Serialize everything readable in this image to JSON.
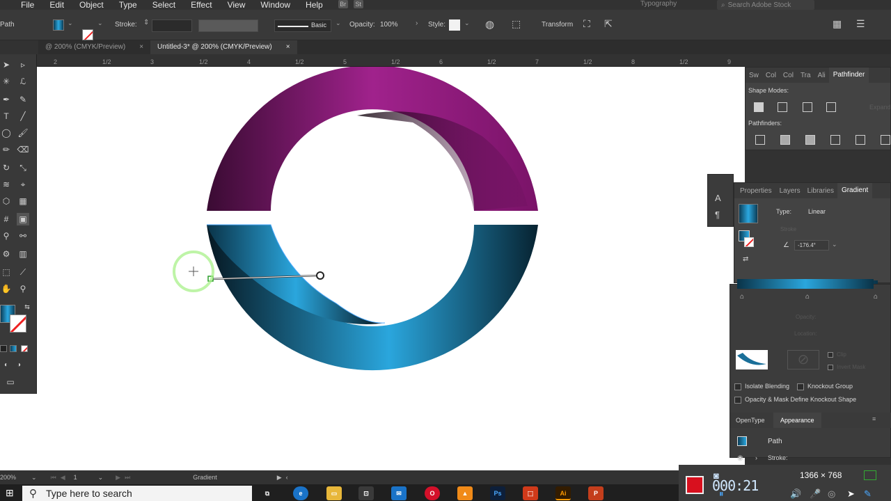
{
  "menubar": {
    "items": [
      "File",
      "Edit",
      "Object",
      "Type",
      "Select",
      "Effect",
      "View",
      "Window",
      "Help"
    ],
    "badges": [
      "Br",
      "St"
    ],
    "workspace": "Typography",
    "search_placeholder": "Search Adobe Stock"
  },
  "controlbar": {
    "selection_label": "Path",
    "stroke_label": "Stroke:",
    "brush_label": "Basic",
    "opacity_label": "Opacity:",
    "opacity_value": "100%",
    "style_label": "Style:",
    "transform_label": "Transform"
  },
  "tabs": [
    {
      "label": "@ 200% (CMYK/Preview)",
      "active": false
    },
    {
      "label": "Untitled-3* @ 200% (CMYK/Preview)",
      "active": true
    }
  ],
  "ruler": {
    "labels": [
      "2",
      "1/2",
      "3",
      "1/2",
      "4",
      "1/2",
      "5",
      "1/2",
      "6",
      "1/2",
      "7",
      "1/2",
      "8",
      "1/2",
      "9"
    ]
  },
  "pathfinder_panel": {
    "tabs": [
      "Sw",
      "Col",
      "Col",
      "Tra",
      "Ali",
      "Pathfinder"
    ],
    "shape_modes_label": "Shape Modes:",
    "expand_label": "Expand",
    "pathfinders_label": "Pathfinders:"
  },
  "gradient_panel": {
    "tabs": [
      "Properties",
      "Layers",
      "Libraries",
      "Gradient"
    ],
    "type_label": "Type:",
    "type_value": "Linear",
    "stroke_label": "Stroke",
    "angle_value": "-176.4°",
    "opacity_label": "Opacity:",
    "location_label": "Location:",
    "gradient_colors": [
      "#0a3348",
      "#2aa6dd",
      "#0a3348"
    ]
  },
  "transparency": {
    "clip_label": "Clip",
    "invert_mask_label": "Invert Mask",
    "isolate_blending": "Isolate Blending",
    "knockout_group": "Knockout Group",
    "opacity_mask": "Opacity & Mask Define Knockout Shape"
  },
  "appearance_panel": {
    "tabs": [
      "OpenType",
      "Appearance"
    ],
    "path_label": "Path",
    "stroke_label": "Stroke:"
  },
  "statusbar": {
    "zoom": "200%",
    "artboard_number": "1",
    "tool_name": "Gradient"
  },
  "taskbar": {
    "search_placeholder": "Type here to search",
    "apps": [
      "Ps",
      "Ai"
    ]
  },
  "recorder": {
    "resolution": "1366 × 768",
    "timer": "000:21"
  },
  "colors": {
    "magenta": "#9a1f86",
    "cyan": "#2aa6dd",
    "dark": "#071a24",
    "ui_dark": "#323232"
  }
}
